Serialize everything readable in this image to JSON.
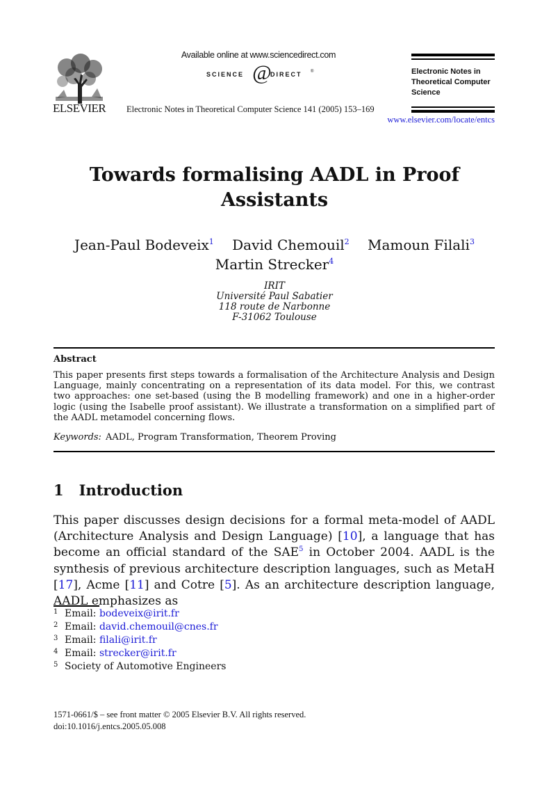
{
  "header": {
    "publisher": "ELSEVIER",
    "available_online": "Available online at www.sciencedirect.com",
    "sciencedirect_logo": {
      "left": "SCIENCE",
      "right": "DIRECT",
      "mark": "d",
      "tm": "®"
    },
    "journal_citation": "Electronic Notes in Theoretical Computer Science 141 (2005) 153–169",
    "journal_box_lines": [
      "Electronic Notes in",
      "Theoretical Computer",
      "Science"
    ],
    "journal_url": "www.elsevier.com/locate/entcs"
  },
  "paper": {
    "title_lines": [
      "Towards formalising AADL in Proof",
      "Assistants"
    ],
    "authors": [
      {
        "name": "Jean-Paul Bodeveix",
        "mark": "1"
      },
      {
        "name": "David Chemouil",
        "mark": "2"
      },
      {
        "name": "Mamoun Filali",
        "mark": "3"
      },
      {
        "name": "Martin Strecker",
        "mark": "4"
      }
    ],
    "affiliation_lines": [
      "IRIT",
      "Université Paul Sabatier",
      "118 route de Narbonne",
      "F-31062 Toulouse"
    ]
  },
  "abstract": {
    "heading": "Abstract",
    "text": "This paper presents first steps towards a formalisation of the Architecture Analysis and Design Language, mainly concentrating on a representation of its data model. For this, we contrast two approaches: one set-based (using the B modelling framework) and one in a higher-order logic (using the Isabelle proof assistant). We illustrate a transformation on a simplified part of the AADL metamodel concerning flows.",
    "keywords_label": "Keywords:",
    "keywords": "AADL, Program Transformation, Theorem Proving"
  },
  "section": {
    "number": "1",
    "title": "Introduction",
    "segments": [
      {
        "t": "This paper discusses design decisions for a formal meta-model of AADL (Architecture Analysis and Design Language) "
      },
      {
        "ref": "[10]"
      },
      {
        "t": ", a language that has become an official standard of the SAE"
      },
      {
        "sup": "5"
      },
      {
        "t": " in October 2004. AADL is the synthesis of previous architecture description languages, such as MetaH "
      },
      {
        "ref": "[17]"
      },
      {
        "t": ", Acme "
      },
      {
        "ref": "[11]"
      },
      {
        "t": " and Cotre "
      },
      {
        "ref": "[5]"
      },
      {
        "t": ". As an architecture description language, AADL emphasizes as"
      }
    ]
  },
  "footnotes": [
    {
      "mark": "1",
      "label": "Email:",
      "email": "bodeveix@irit.fr"
    },
    {
      "mark": "2",
      "label": "Email:",
      "email": "david.chemouil@cnes.fr"
    },
    {
      "mark": "3",
      "label": "Email:",
      "email": "filali@irit.fr"
    },
    {
      "mark": "4",
      "label": "Email:",
      "email": "strecker@irit.fr"
    },
    {
      "mark": "5",
      "label": "Society of Automotive Engineers",
      "email": ""
    }
  ],
  "copyright": {
    "line1": "1571-0661/$ – see front matter © 2005 Elsevier B.V. All rights reserved.",
    "doi": "doi:10.1016/j.entcs.2005.05.008"
  }
}
